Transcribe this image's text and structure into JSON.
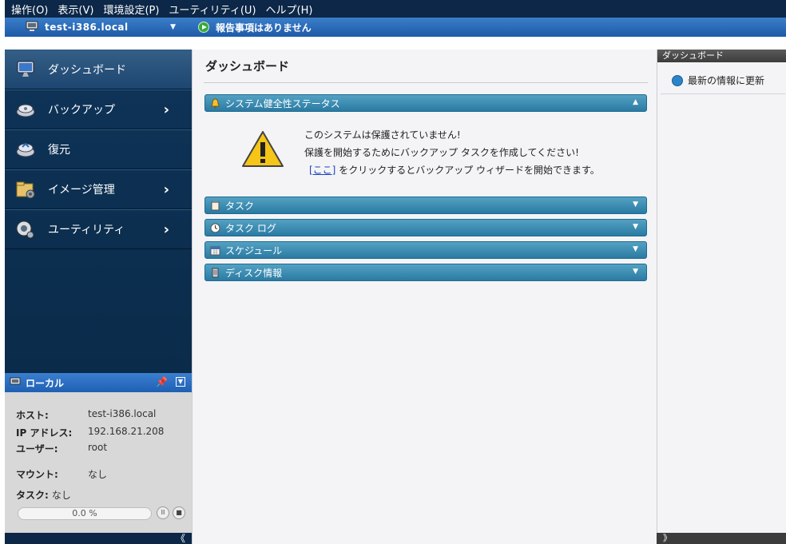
{
  "menubar": {
    "items": [
      "操作(O)",
      "表示(V)",
      "環境設定(P)",
      "ユーティリティ(U)",
      "ヘルプ(H)"
    ]
  },
  "machinebar": {
    "machine_name": "test-i386.local",
    "status_text": "報告事項はありません"
  },
  "nav": {
    "items": [
      {
        "label": "ダッシュボード",
        "icon": "monitor-icon"
      },
      {
        "label": "バックアップ",
        "icon": "backup-icon"
      },
      {
        "label": "復元",
        "icon": "restore-icon"
      },
      {
        "label": "イメージ管理",
        "icon": "folder-gear-icon"
      },
      {
        "label": "ユーティリティ",
        "icon": "utility-icon"
      }
    ]
  },
  "local": {
    "title": "ローカル",
    "host_label": "ホスト:",
    "host_value": "test-i386.local",
    "ip_label": "IP アドレス:",
    "ip_value": "192.168.21.208",
    "user_label": "ユーザー:",
    "user_value": "root",
    "mount_label": "マウント:",
    "mount_value": "なし",
    "task_label": "タスク:",
    "task_value": "なし",
    "progress_text": "0.0 %",
    "progress_value": 0.0
  },
  "main": {
    "title": "ダッシュボード",
    "health_panel_title": "システム健全性ステータス",
    "alert_line1": "このシステムは保護されていません!",
    "alert_line2": "保護を開始するためにバックアップ タスクを作成してください!",
    "alert_link": "[ここ]",
    "alert_line3": " をクリックするとバックアップ ウィザードを開始できます。",
    "panels": [
      {
        "title": "タスク"
      },
      {
        "title": "タスク ログ"
      },
      {
        "title": "スケジュール"
      },
      {
        "title": "ディスク情報"
      }
    ]
  },
  "right": {
    "title": "ダッシュボード",
    "action": "最新の情報に更新"
  },
  "footer": {
    "left_arrow": "《",
    "right_arrow": "》"
  },
  "colors": {
    "menubar": "#0c2747",
    "machinebar": "#1e5aa8",
    "nav_bg": "#0e3458",
    "panel_bar": "#3b8bb3",
    "status_green": "#39a83d"
  }
}
